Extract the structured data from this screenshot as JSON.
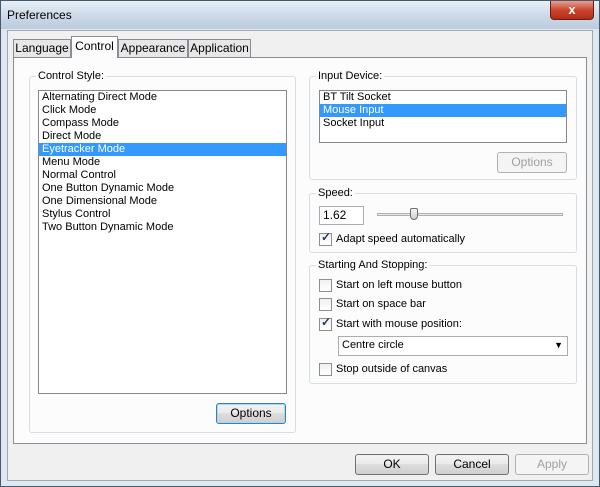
{
  "window": {
    "title": "Preferences",
    "close_glyph": "x"
  },
  "tabs": [
    {
      "label": "Language",
      "active": false
    },
    {
      "label": "Control",
      "active": true
    },
    {
      "label": "Appearance",
      "active": false
    },
    {
      "label": "Application",
      "active": false
    }
  ],
  "control_style": {
    "label": "Control Style:",
    "items": [
      "Alternating Direct Mode",
      "Click Mode",
      "Compass Mode",
      "Direct Mode",
      "Eyetracker Mode",
      "Menu Mode",
      "Normal Control",
      "One Button Dynamic Mode",
      "One Dimensional Mode",
      "Stylus Control",
      "Two Button Dynamic Mode"
    ],
    "selected": "Eyetracker Mode",
    "options_button": "Options"
  },
  "input_device": {
    "label": "Input Device:",
    "items": [
      "BT Tilt Socket",
      "Mouse Input",
      "Socket Input"
    ],
    "selected": "Mouse Input",
    "options_button": "Options"
  },
  "speed": {
    "label": "Speed:",
    "value": "1.62",
    "slider_fraction": 0.2,
    "adapt_label": "Adapt speed automatically",
    "adapt_checked": true
  },
  "starting": {
    "label": "Starting And Stopping:",
    "left_mouse": {
      "label": "Start on left mouse button",
      "checked": false
    },
    "space_bar": {
      "label": "Start on space bar",
      "checked": false
    },
    "mouse_position": {
      "label": "Start with mouse position:",
      "checked": true
    },
    "position_select": "Centre circle",
    "outside_canvas": {
      "label": "Stop outside of canvas",
      "checked": false
    }
  },
  "footer": {
    "ok": "OK",
    "cancel": "Cancel",
    "apply": "Apply"
  },
  "colors": {
    "selection": "#3399ff",
    "title_bar": "#c9d7e6",
    "close_button": "#c9462f"
  }
}
